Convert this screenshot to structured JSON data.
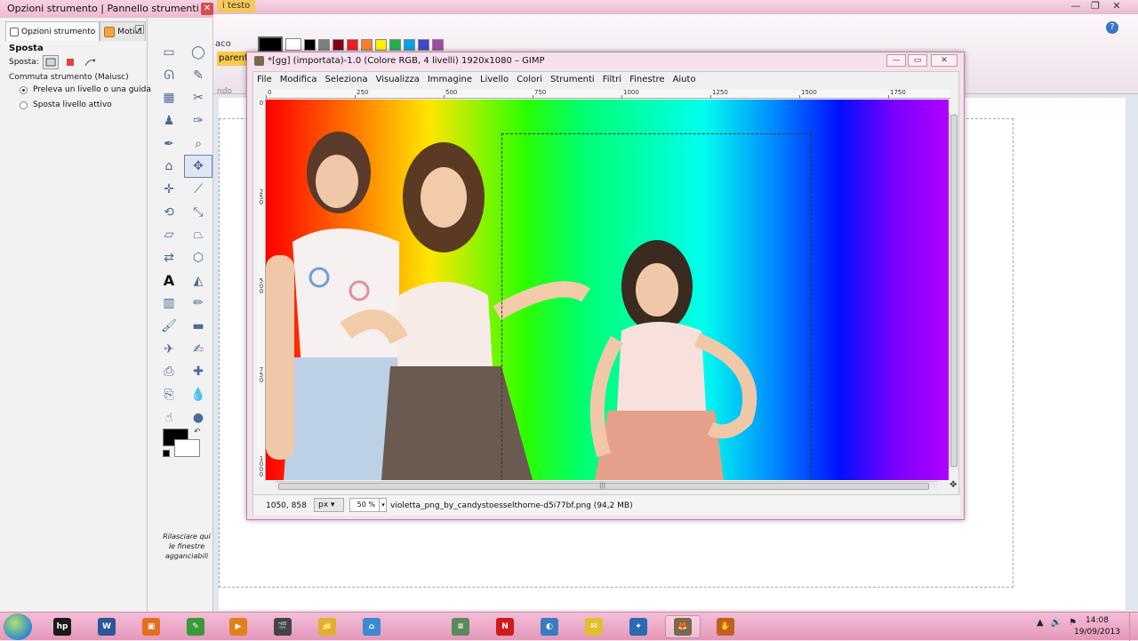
{
  "colors": {
    "accent": "#f4a340",
    "taskbar": "#e9a3c3",
    "title_pink": "#f6d2e3"
  },
  "background_app": {
    "tab_label": "i testo",
    "ribbon_label1": "aco",
    "ribbon_label2": "parente",
    "ribbon_label3": "ndo",
    "help_glyph": "?",
    "palette": [
      "#000000",
      "#ffffff",
      "#000000",
      "#808080",
      "#880015",
      "#ed1c24",
      "#ff7f27",
      "#fff200",
      "#22b14c",
      "#00a2e8",
      "#3f48cc",
      "#a349a4"
    ]
  },
  "toolbox": {
    "title": "Opzioni strumento | Pannello strumenti",
    "close_glyph": "✕",
    "tabs": [
      {
        "label": "Opzioni strumento"
      },
      {
        "label": "Motivi"
      }
    ],
    "tabs_menu_glyph": "◂",
    "options_title": "Sposta",
    "mode_label": "Sposta:",
    "switch_label": "Commuta strumento (Maiusc)",
    "radios": [
      {
        "label": "Preleva un livello o una guida",
        "checked": true
      },
      {
        "label": "Sposta livello attivo",
        "checked": false
      }
    ],
    "drop_hint": "Rilasciare qui le finestre agganciabili",
    "tools": [
      {
        "icon": "rect-select-icon",
        "glyph": "▭"
      },
      {
        "icon": "ellipse-select-icon",
        "glyph": "◯"
      },
      {
        "icon": "free-select-icon",
        "glyph": "ᘏ"
      },
      {
        "icon": "fuzzy-select-icon",
        "glyph": "✎"
      },
      {
        "icon": "color-select-icon",
        "glyph": "▦"
      },
      {
        "icon": "scissors-icon",
        "glyph": "✂"
      },
      {
        "icon": "foreground-select-icon",
        "glyph": "♟"
      },
      {
        "icon": "paths-icon",
        "glyph": "✑"
      },
      {
        "icon": "color-picker-icon",
        "glyph": "✒"
      },
      {
        "icon": "zoom-icon",
        "glyph": "⌕"
      },
      {
        "icon": "measure-icon",
        "glyph": "⌂"
      },
      {
        "icon": "move-icon",
        "glyph": "✥"
      },
      {
        "icon": "align-icon",
        "glyph": "✛"
      },
      {
        "icon": "crop-icon",
        "glyph": "⟋"
      },
      {
        "icon": "rotate-icon",
        "glyph": "⟲"
      },
      {
        "icon": "scale-icon",
        "glyph": "⤡"
      },
      {
        "icon": "shear-icon",
        "glyph": "▱"
      },
      {
        "icon": "perspective-icon",
        "glyph": "⏢"
      },
      {
        "icon": "flip-icon",
        "glyph": "⇄"
      },
      {
        "icon": "cage-icon",
        "glyph": "⬡"
      },
      {
        "icon": "text-icon",
        "glyph": "A"
      },
      {
        "icon": "bucket-fill-icon",
        "glyph": "◭"
      },
      {
        "icon": "blend-icon",
        "glyph": "▥"
      },
      {
        "icon": "pencil-icon",
        "glyph": "✏"
      },
      {
        "icon": "paintbrush-icon",
        "glyph": "🖌"
      },
      {
        "icon": "eraser-icon",
        "glyph": "▬"
      },
      {
        "icon": "airbrush-icon",
        "glyph": "✈"
      },
      {
        "icon": "ink-icon",
        "glyph": "✍"
      },
      {
        "icon": "clone-icon",
        "glyph": "⎙"
      },
      {
        "icon": "heal-icon",
        "glyph": "✚"
      },
      {
        "icon": "perspective-clone-icon",
        "glyph": "⎘"
      },
      {
        "icon": "blur-icon",
        "glyph": "💧"
      },
      {
        "icon": "smudge-icon",
        "glyph": "☝"
      },
      {
        "icon": "dodge-burn-icon",
        "glyph": "●"
      }
    ],
    "fg_color": "#000000",
    "bg_color": "#ffffff",
    "swap_glyph": "↶"
  },
  "gimp": {
    "title": "*[gg] (importata)-1.0 (Colore RGB, 4 livelli) 1920x1080 – GIMP",
    "controls": {
      "minimize": "—",
      "maximize": "▭",
      "close": "✕"
    },
    "menu": [
      "File",
      "Modifica",
      "Seleziona",
      "Visualizza",
      "Immagine",
      "Livello",
      "Colori",
      "Strumenti",
      "Filtri",
      "Finestre",
      "Aiuto"
    ],
    "ruler_top": [
      "0",
      "250",
      "500",
      "750",
      "1000",
      "1250",
      "1500",
      "1750"
    ],
    "ruler_left": [
      "0",
      "250",
      "500",
      "750",
      "1000"
    ],
    "status": {
      "coords": "1050, 858",
      "unit": "px",
      "unit_arrow": "▾",
      "zoom": "50 %",
      "zoom_arrow": "▾",
      "file_info": "violetta_png_by_candystoesselthorne-d5i77bf.png (94,2 MB)"
    },
    "navigate_glyph": "✥",
    "scroll_grip": "|||"
  },
  "taskbar": {
    "apps": [
      {
        "name": "hp-icon",
        "glyph": "hp",
        "color": "#1a1a1a"
      },
      {
        "name": "word-icon",
        "glyph": "W",
        "color": "#2b5797"
      },
      {
        "name": "office-icon",
        "glyph": "▣",
        "color": "#e07020"
      },
      {
        "name": "paint-icon",
        "glyph": "✎",
        "color": "#3a9a3a"
      },
      {
        "name": "media-player-icon",
        "glyph": "▶",
        "color": "#e0801a"
      },
      {
        "name": "movie-maker-icon",
        "glyph": "🎬",
        "color": "#444"
      },
      {
        "name": "explorer-icon",
        "glyph": "📁",
        "color": "#e0b030"
      },
      {
        "name": "network-icon",
        "glyph": "⌂",
        "color": "#3a8ad2"
      },
      {
        "name": "notepad-icon",
        "glyph": "≡",
        "color": "#5a8a5a"
      },
      {
        "name": "antivirus-icon",
        "glyph": "N",
        "color": "#d01a1a"
      },
      {
        "name": "photo-icon",
        "glyph": "◐",
        "color": "#3a7ac2"
      },
      {
        "name": "notes-icon",
        "glyph": "✉",
        "color": "#e0c030"
      },
      {
        "name": "image-editor-icon",
        "glyph": "✦",
        "color": "#2a6ab0"
      },
      {
        "name": "gimp-icon",
        "glyph": "🦊",
        "color": "#7b6a4a"
      },
      {
        "name": "tool-icon",
        "glyph": "✋",
        "color": "#c06020"
      }
    ],
    "tray": [
      "▲",
      "🔊",
      "⚑"
    ],
    "time": "14:08",
    "date": "19/09/2013"
  }
}
